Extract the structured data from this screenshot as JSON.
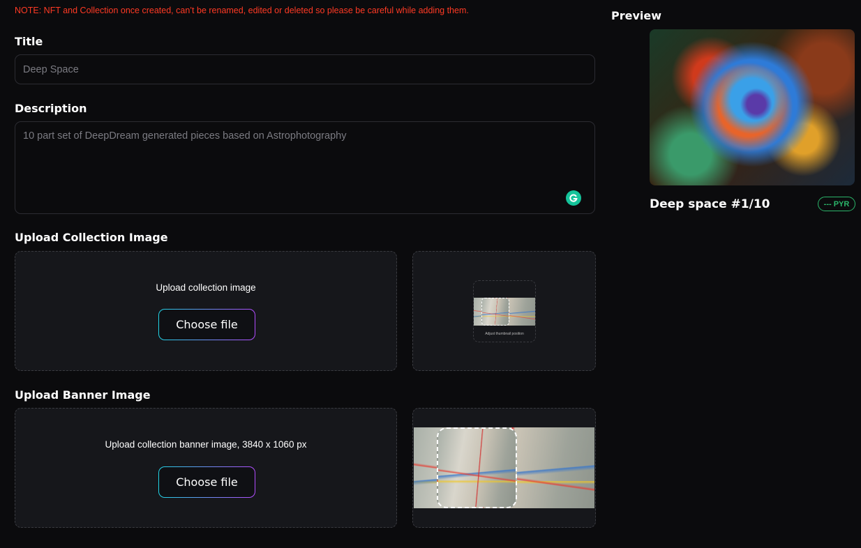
{
  "note": "NOTE: NFT and Collection once created, can’t be renamed, edited or deleted so please be careful while adding them.",
  "form": {
    "title_label": "Title",
    "title_value": "Deep Space",
    "description_label": "Description",
    "description_value": "10 part set of DeepDream generated pieces based on Astrophotography",
    "collection_image_label": "Upload Collection Image",
    "collection_image_prompt": "Upload collection image",
    "choose_file_label": "Choose file",
    "thumb_caption": "Adjust thumbnail position",
    "banner_image_label": "Upload Banner Image",
    "banner_image_prompt": "Upload collection banner image, 3840 x 1060 px"
  },
  "preview": {
    "heading": "Preview",
    "nft_title": "Deep space #1/10",
    "price_badge": "--- PYR"
  },
  "colors": {
    "note": "#ff3a24",
    "badge": "#2bb56a",
    "grammarly": "#15c39a",
    "button_gradient_start": "#21d4e6",
    "button_gradient_end": "#b34cff"
  },
  "icons": [
    "grammarly-icon"
  ]
}
